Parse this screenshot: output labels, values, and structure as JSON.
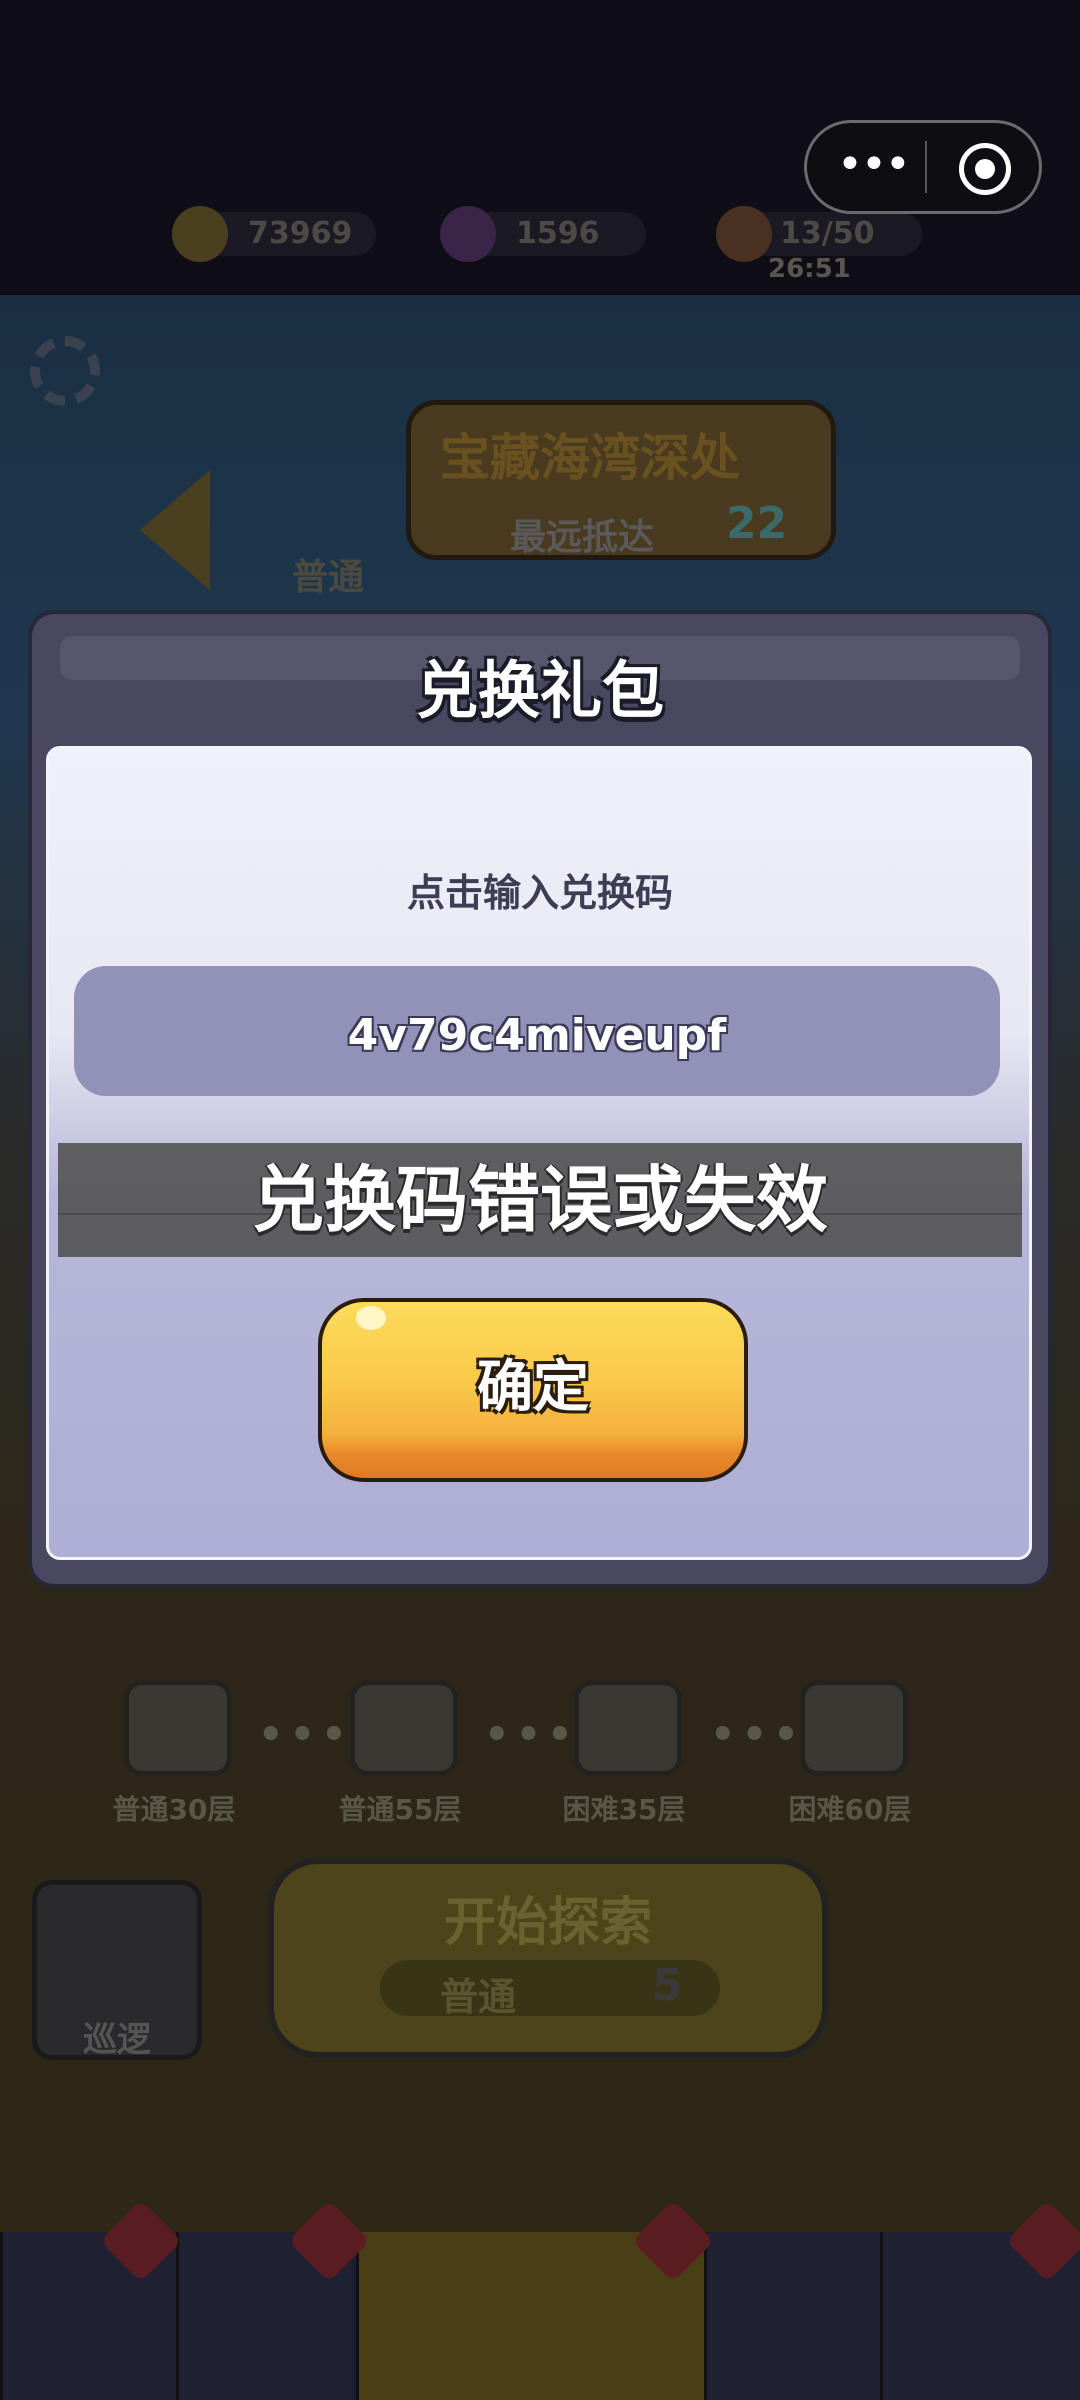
{
  "topbar": {
    "gold": "73969",
    "gems": "1596",
    "energy": "13/50",
    "timer": "26:51",
    "more_icon": "more-dots-icon",
    "close_icon": "record-icon"
  },
  "background": {
    "banner_title": "宝藏海湾深处",
    "banner_sub": "最远抵达",
    "banner_num": "22",
    "mode_label": "普通",
    "chests": [
      {
        "label": "普通30层"
      },
      {
        "label": "普通55层"
      },
      {
        "label": "困难35层"
      },
      {
        "label": "困难60层"
      }
    ],
    "start_label": "开始探索",
    "start_mode": "普通",
    "start_cost": "5",
    "patrol_label": "巡逻"
  },
  "dialog": {
    "title": "兑换礼包",
    "prompt": "点击输入兑换码",
    "code_value": "4v79c4miveupf",
    "error_toast": "兑换码错误或失效",
    "confirm_label": "确定"
  },
  "colors": {
    "accent_button": "#f9c94a",
    "panel_input": "#9291b7",
    "modal_frame": "#4a4860"
  }
}
